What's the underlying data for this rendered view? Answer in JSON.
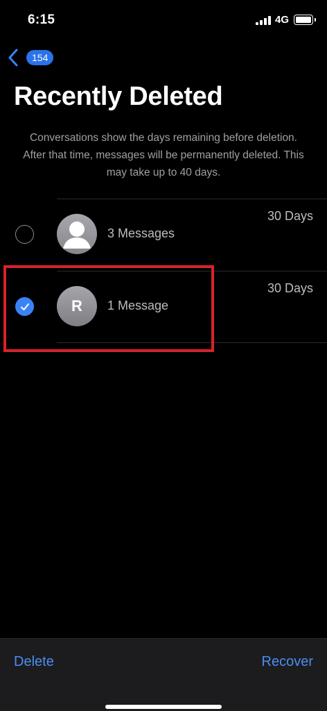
{
  "status_bar": {
    "time": "6:15",
    "network": "4G",
    "signal_bars": 4,
    "battery_level": 1.0
  },
  "nav": {
    "back_count": "154",
    "back_icon": "chevron-left-icon"
  },
  "page": {
    "title": "Recently Deleted",
    "description": "Conversations show the days remaining before deletion. After that time, messages will be permanently deleted. This may take up to 40 days."
  },
  "conversations": [
    {
      "label": "3 Messages",
      "days": "30 Days",
      "selected": false,
      "avatar": "person-silhouette-icon"
    },
    {
      "label": "1 Message",
      "days": "30 Days",
      "selected": true,
      "avatar_initial": "R"
    }
  ],
  "toolbar": {
    "delete_label": "Delete",
    "recover_label": "Recover"
  },
  "colors": {
    "accent": "#3b82f6",
    "highlight": "#d9222a",
    "background": "#000000"
  }
}
